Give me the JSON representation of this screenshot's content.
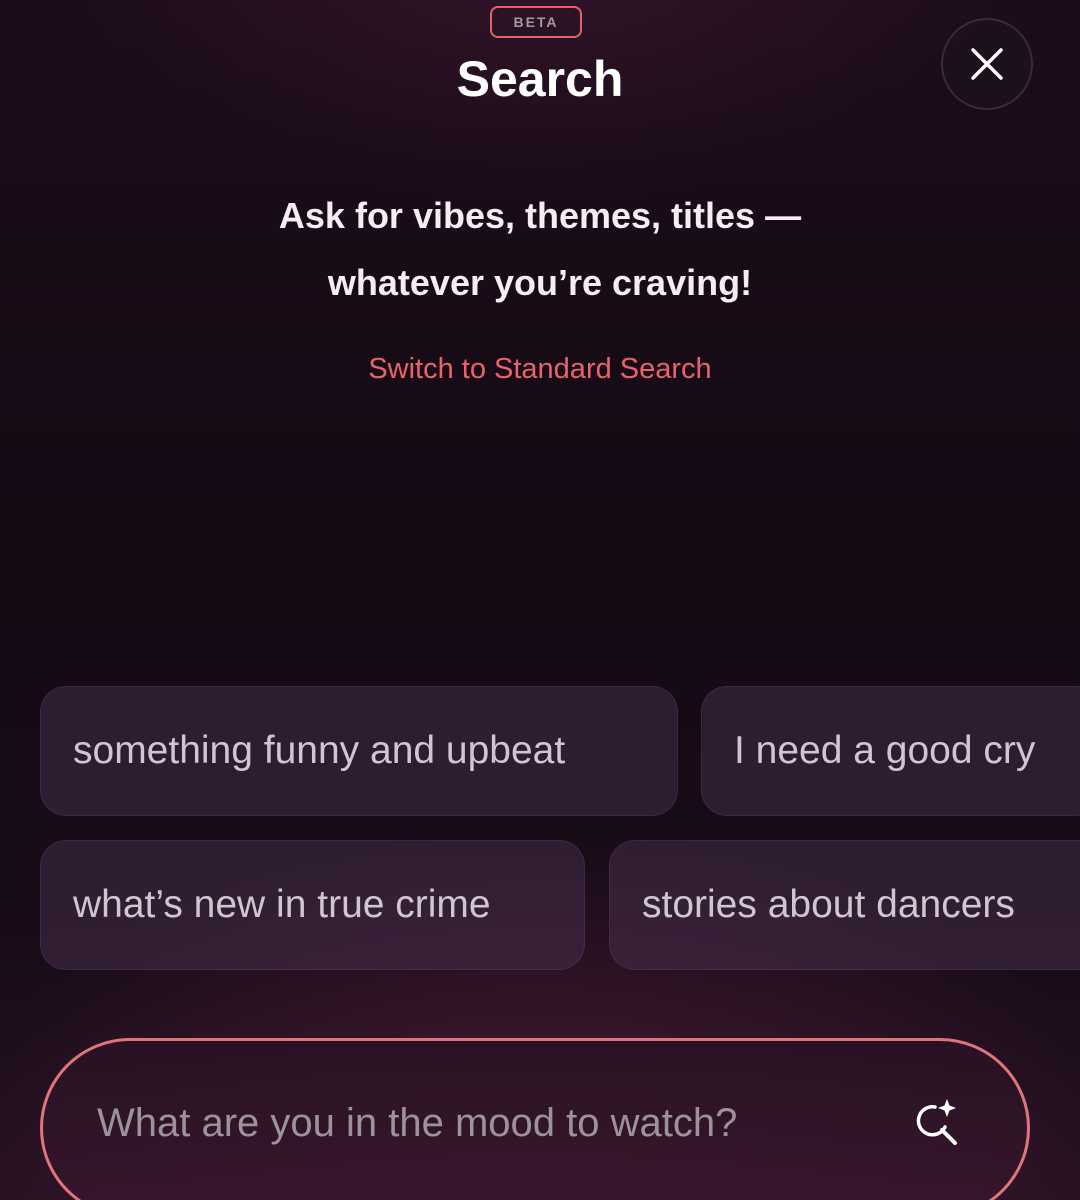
{
  "header": {
    "badge": "BETA",
    "title": "Search",
    "close_icon": "close-icon"
  },
  "intro": {
    "line1": "Ask for vibes, themes, titles —",
    "line2": "whatever you’re craving!",
    "switch_link": "Switch to Standard Search"
  },
  "suggestions": [
    "something funny and upbeat",
    "I need a good cry",
    "what’s new in true crime",
    "stories about dancers"
  ],
  "search": {
    "value": "",
    "placeholder": "What are you in the mood to watch?",
    "icon": "sparkle-search-icon"
  },
  "colors": {
    "accent": "#e0626c",
    "background": "#1a0d18",
    "chip": "#3a2a3d"
  }
}
